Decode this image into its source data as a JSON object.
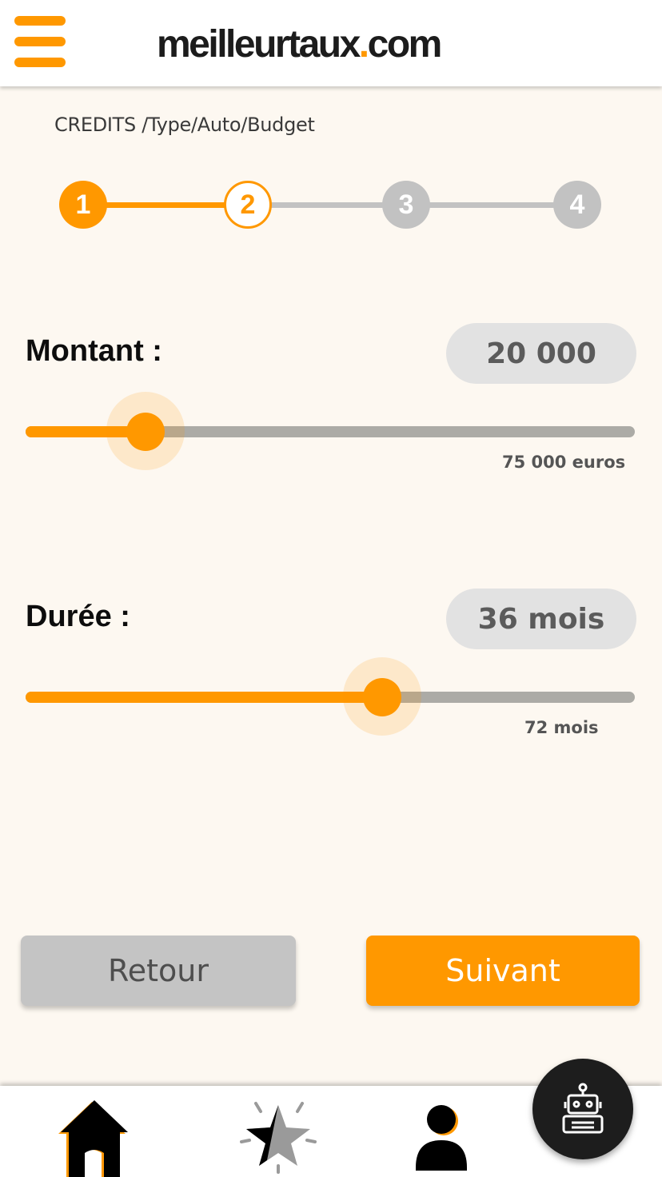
{
  "header": {
    "logo_main": "meilleurtaux",
    "logo_dot": ".",
    "logo_tld": "com",
    "menu_icon": "hamburger-menu-icon"
  },
  "breadcrumb": "CREDITS /Type/Auto/Budget",
  "stepper": {
    "steps": [
      "1",
      "2",
      "3",
      "4"
    ],
    "current_step": 2
  },
  "amount": {
    "label": "Montant :",
    "value": "20 000",
    "max_label": "75 000 euros",
    "slider_fraction": 0.197
  },
  "duration": {
    "label": "Durée :",
    "value": "36 mois",
    "max_label": "72 mois",
    "slider_fraction": 0.585
  },
  "buttons": {
    "back": "Retour",
    "next": "Suivant"
  },
  "nav": {
    "items": [
      "home-icon",
      "favorites-star-icon",
      "user-icon"
    ],
    "assistant_icon": "robot-icon"
  },
  "colors": {
    "accent": "#ff9800",
    "background": "#fdf8f1",
    "inactive": "#c2c2c2"
  }
}
